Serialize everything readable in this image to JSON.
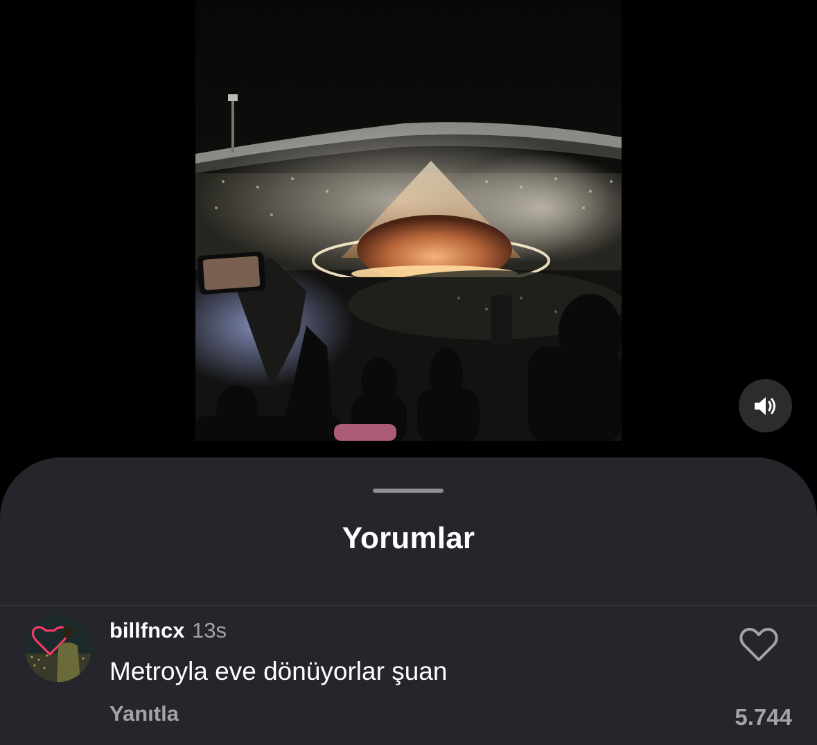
{
  "video": {
    "description_icon": "concert-video",
    "volume_icon": "speaker-icon"
  },
  "comments_sheet": {
    "title": "Yorumlar"
  },
  "comment": {
    "username": "billfncx",
    "timestamp": "13s",
    "text": "Metroyla eve dönüyorlar şuan",
    "reply_label": "Yanıtla",
    "like_count": "5.744",
    "like_icon": "heart-outline-icon"
  },
  "colors": {
    "background": "#000000",
    "sheet": "#25262b",
    "primary_text": "#ffffff",
    "secondary_text": "#a3a3a8"
  }
}
